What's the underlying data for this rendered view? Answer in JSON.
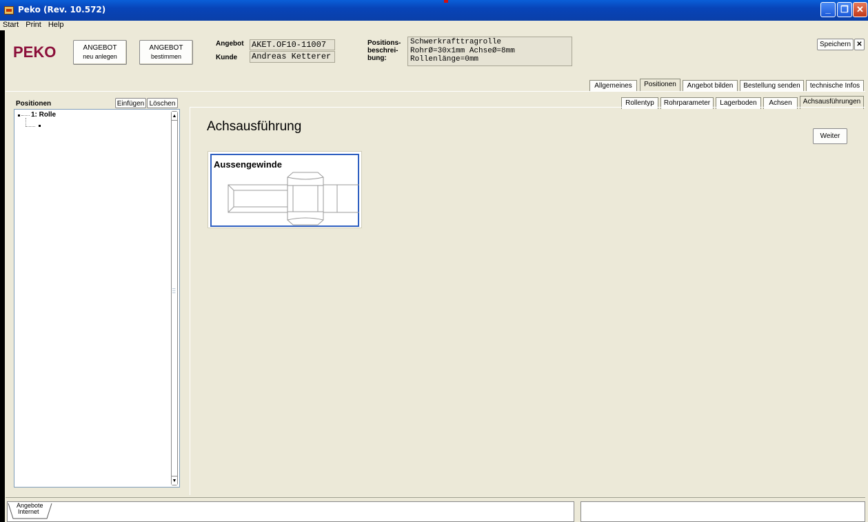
{
  "window": {
    "title": "Peko (Rev. 10.572)",
    "controls": {
      "minimize": "_",
      "maximize": "❐",
      "close": "✕"
    }
  },
  "menu": [
    "Start",
    "Print",
    "Help"
  ],
  "header": {
    "logo": "PEKO",
    "btn_new": {
      "line1": "ANGEBOT",
      "line2": "neu anlegen"
    },
    "btn_select": {
      "line1": "ANGEBOT",
      "line2": "bestimmen"
    },
    "angebot_label": "Angebot",
    "angebot_value": "AKET.OF10-11007",
    "kunde_label": "Kunde",
    "kunde_value": "Andreas Ketterer",
    "desc_label": [
      "Positions-",
      "beschrei-",
      "bung:"
    ],
    "desc_lines": [
      "Schwerkrafttragrolle",
      "RohrØ=30x1mm AchseØ=8mm",
      "Rollenlänge=0mm"
    ],
    "save_label": "Speichern",
    "close_label": "✕"
  },
  "main_tabs": [
    "Allgemeines",
    "Positionen",
    "Angebot bilden",
    "Bestellung senden",
    "technische Infos"
  ],
  "main_tab_active": "Positionen",
  "positions": {
    "title": "Positionen",
    "insert_label": "Einfügen",
    "delete_label": "Löschen",
    "items": [
      "1: Rolle"
    ]
  },
  "sub_tabs": [
    "Rollentyp",
    "Rohrparameter",
    "Lagerboden",
    "Achsen",
    "Achsausführungen"
  ],
  "sub_tab_active": "Achsausführungen",
  "content": {
    "heading": "Achsausführung",
    "next_label": "Weiter",
    "option_title": "Aussengewinde",
    "option_icon": "threaded-axle-nut-drawing"
  },
  "bottom": {
    "tab_label_lines": [
      "Angebote",
      "Internet"
    ]
  }
}
